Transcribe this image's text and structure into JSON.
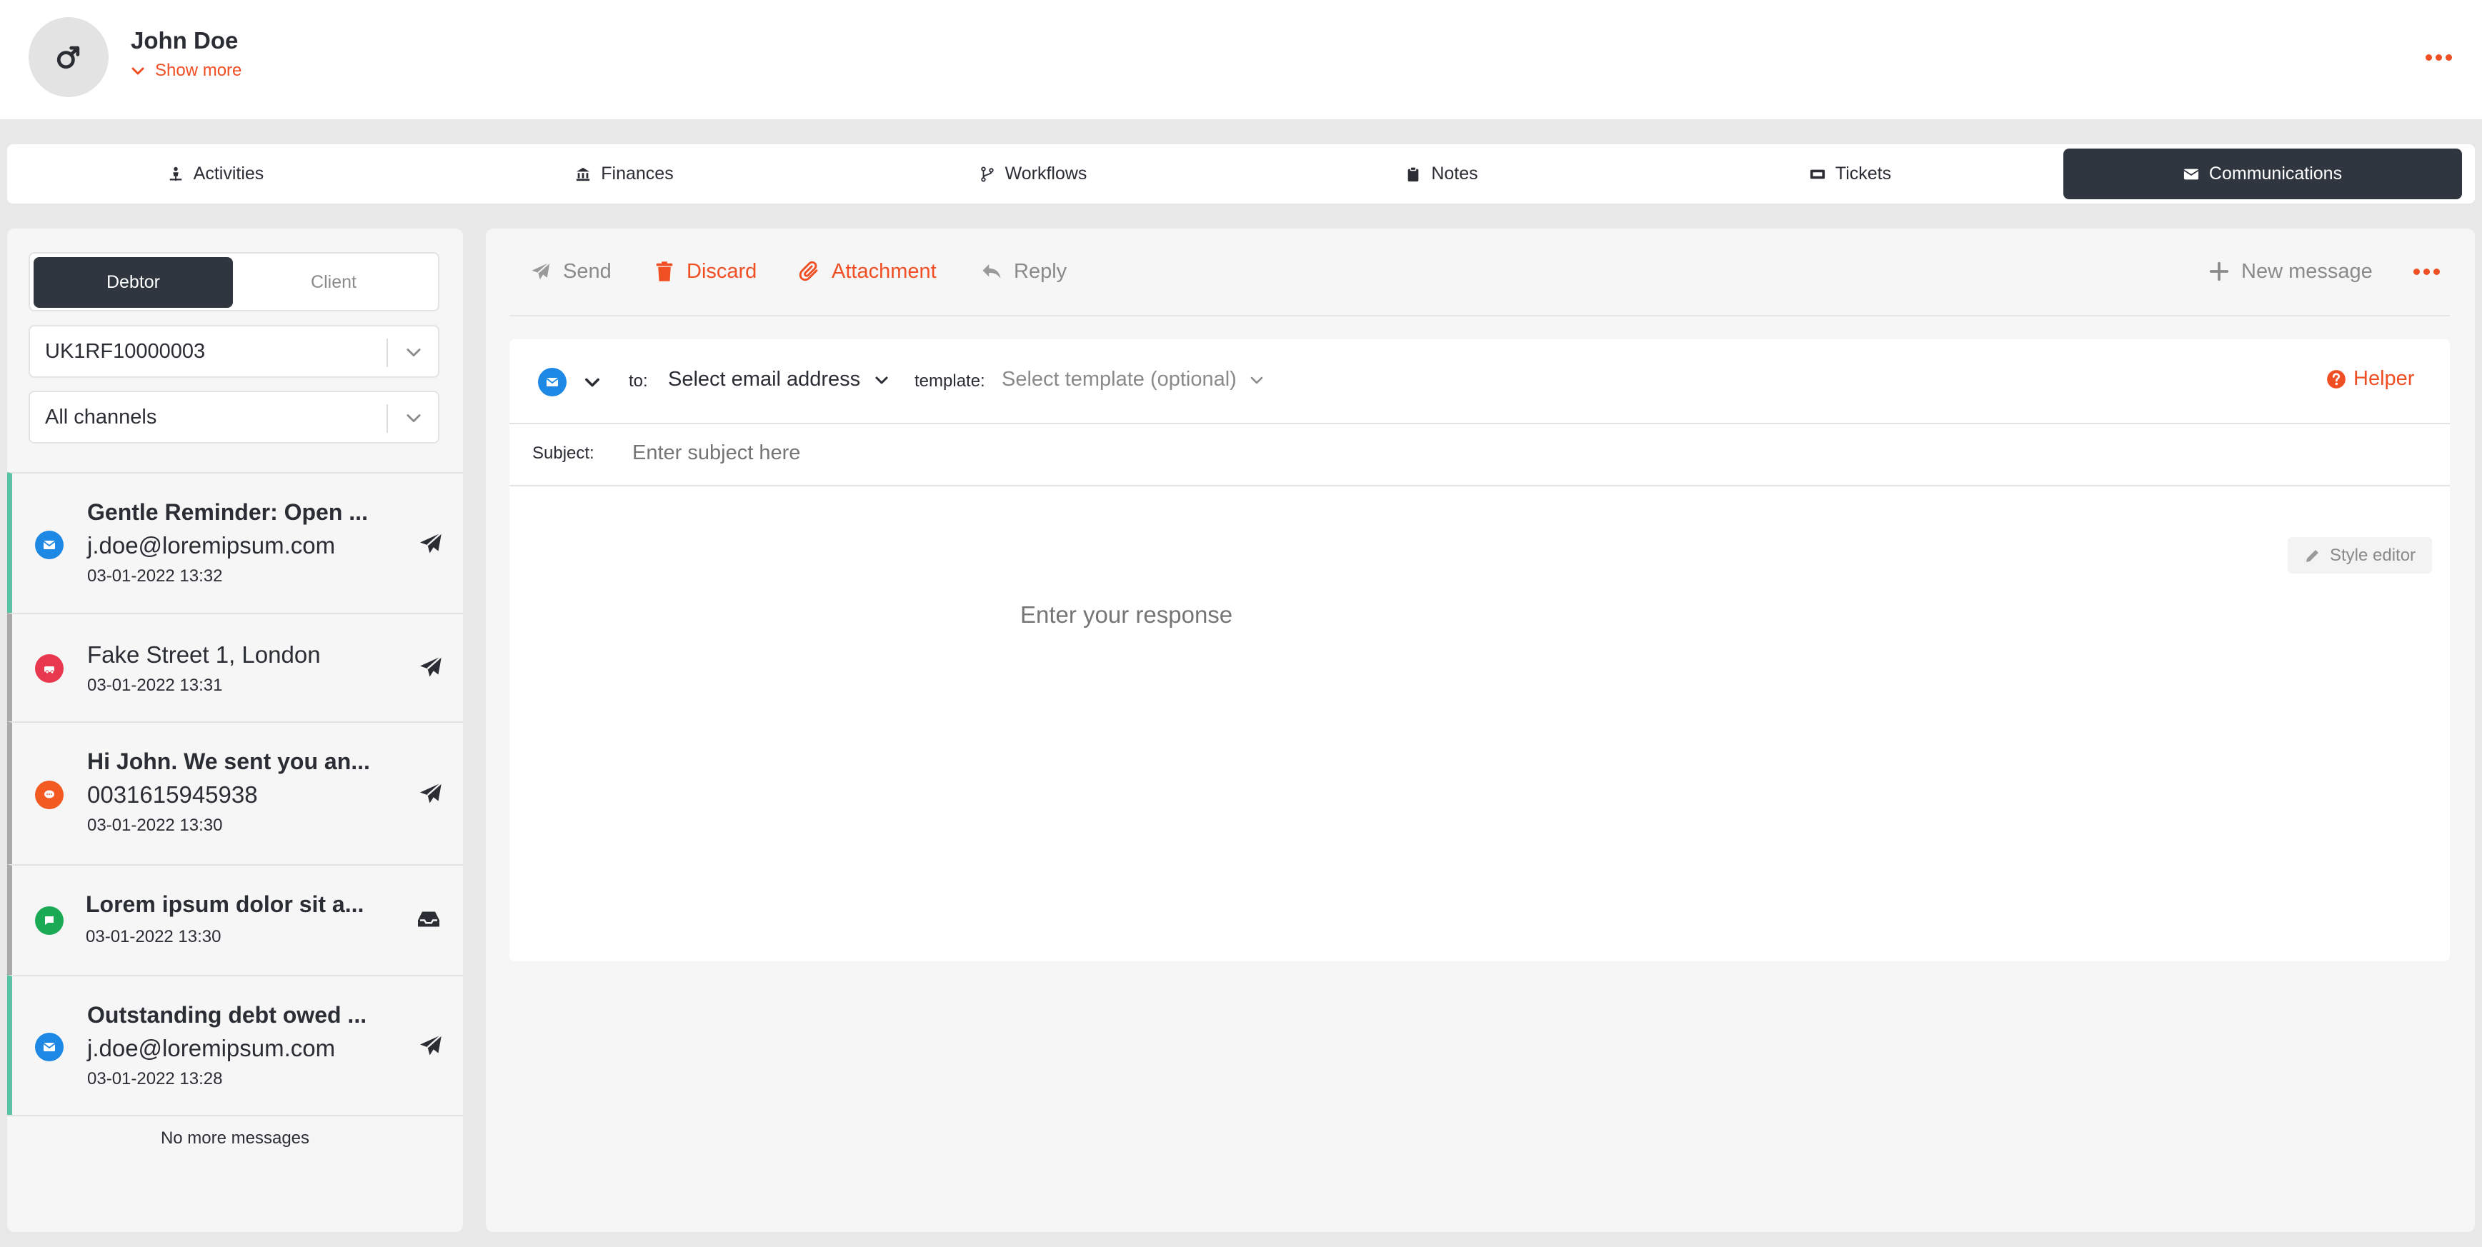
{
  "colors": {
    "accent": "#f04e23",
    "dark": "#2f3640",
    "email_blue": "#1e88e5",
    "teal": "#59c3a6",
    "green": "#1aaa55",
    "red": "#e8384f",
    "orange": "#f25a22"
  },
  "header": {
    "name": "John Doe",
    "show_more": "Show more",
    "avatar_icon": "mars-icon",
    "more_icon": "ellipsis-icon"
  },
  "tabs": [
    {
      "label": "Activities",
      "icon": "person-icon"
    },
    {
      "label": "Finances",
      "icon": "bank-icon"
    },
    {
      "label": "Workflows",
      "icon": "branch-icon"
    },
    {
      "label": "Notes",
      "icon": "clipboard-icon"
    },
    {
      "label": "Tickets",
      "icon": "ticket-icon"
    },
    {
      "label": "Communications",
      "icon": "envelope-icon",
      "active": true
    }
  ],
  "left": {
    "toggle": {
      "debtor": "Debtor",
      "client": "Client",
      "selected": "Debtor"
    },
    "reference_select": "UK1RF10000003",
    "channel_select": "All channels",
    "messages": [
      {
        "title": "Gentle Reminder: Open ...",
        "sub": "j.doe@loremipsum.com",
        "date": "03-01-2022 13:32",
        "channel": "email",
        "action": "sent"
      },
      {
        "title": "",
        "sub": "Fake Street 1, London",
        "date": "03-01-2022 13:31",
        "channel": "post",
        "action": "sent"
      },
      {
        "title": "Hi John. We sent you an...",
        "sub": "0031615945938",
        "date": "03-01-2022 13:30",
        "channel": "sms",
        "action": "sent"
      },
      {
        "title": "Lorem ipsum dolor sit a...",
        "sub": "",
        "date": "03-01-2022 13:30",
        "channel": "chat",
        "action": "received"
      },
      {
        "title": "Outstanding debt owed ...",
        "sub": "j.doe@loremipsum.com",
        "date": "03-01-2022 13:28",
        "channel": "email",
        "action": "sent"
      }
    ],
    "no_more": "No more messages"
  },
  "toolbar": {
    "send": "Send",
    "discard": "Discard",
    "attachment": "Attachment",
    "reply": "Reply",
    "new_message": "New message"
  },
  "composer": {
    "to_label": "to:",
    "email_select": "Select email address",
    "template_label": "template:",
    "template_select": "Select template (optional)",
    "helper": "Helper",
    "subject_label": "Subject:",
    "subject_placeholder": "Enter subject here",
    "style_editor": "Style editor",
    "response_placeholder": "Enter your response"
  }
}
